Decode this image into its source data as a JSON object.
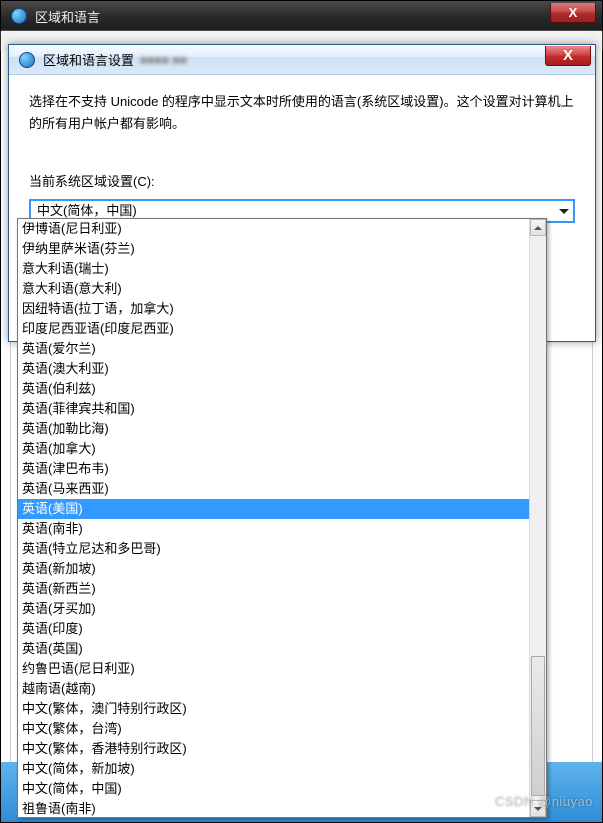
{
  "parent_window": {
    "title": "区域和语言",
    "close_label": "X"
  },
  "dialog": {
    "title": "区域和语言设置",
    "close_label": "X",
    "description": "选择在不支持 Unicode 的程序中显示文本时所使用的语言(系统区域设置)。这个设置对计算机上的所有用户帐户都有影响。",
    "locale_label": "当前系统区域设置(C):",
    "selected_value": "中文(简体，中国)"
  },
  "dropdown_items": [
    {
      "label": "伊博语(尼日利亚)",
      "selected": false
    },
    {
      "label": "伊纳里萨米语(芬兰)",
      "selected": false
    },
    {
      "label": "意大利语(瑞士)",
      "selected": false
    },
    {
      "label": "意大利语(意大利)",
      "selected": false
    },
    {
      "label": "因纽特语(拉丁语，加拿大)",
      "selected": false
    },
    {
      "label": "印度尼西亚语(印度尼西亚)",
      "selected": false
    },
    {
      "label": "英语(爱尔兰)",
      "selected": false
    },
    {
      "label": "英语(澳大利亚)",
      "selected": false
    },
    {
      "label": "英语(伯利兹)",
      "selected": false
    },
    {
      "label": "英语(菲律宾共和国)",
      "selected": false
    },
    {
      "label": "英语(加勒比海)",
      "selected": false
    },
    {
      "label": "英语(加拿大)",
      "selected": false
    },
    {
      "label": "英语(津巴布韦)",
      "selected": false
    },
    {
      "label": "英语(马来西亚)",
      "selected": false
    },
    {
      "label": "英语(美国)",
      "selected": true
    },
    {
      "label": "英语(南非)",
      "selected": false
    },
    {
      "label": "英语(特立尼达和多巴哥)",
      "selected": false
    },
    {
      "label": "英语(新加坡)",
      "selected": false
    },
    {
      "label": "英语(新西兰)",
      "selected": false
    },
    {
      "label": "英语(牙买加)",
      "selected": false
    },
    {
      "label": "英语(印度)",
      "selected": false
    },
    {
      "label": "英语(英国)",
      "selected": false
    },
    {
      "label": "约鲁巴语(尼日利亚)",
      "selected": false
    },
    {
      "label": "越南语(越南)",
      "selected": false
    },
    {
      "label": "中文(繁体，澳门特别行政区)",
      "selected": false
    },
    {
      "label": "中文(繁体，台湾)",
      "selected": false
    },
    {
      "label": "中文(繁体，香港特别行政区)",
      "selected": false
    },
    {
      "label": "中文(简体，新加坡)",
      "selected": false
    },
    {
      "label": "中文(简体，中国)",
      "selected": false
    },
    {
      "label": "祖鲁语(南非)",
      "selected": false
    }
  ],
  "watermark": "CSDN @niuyao"
}
